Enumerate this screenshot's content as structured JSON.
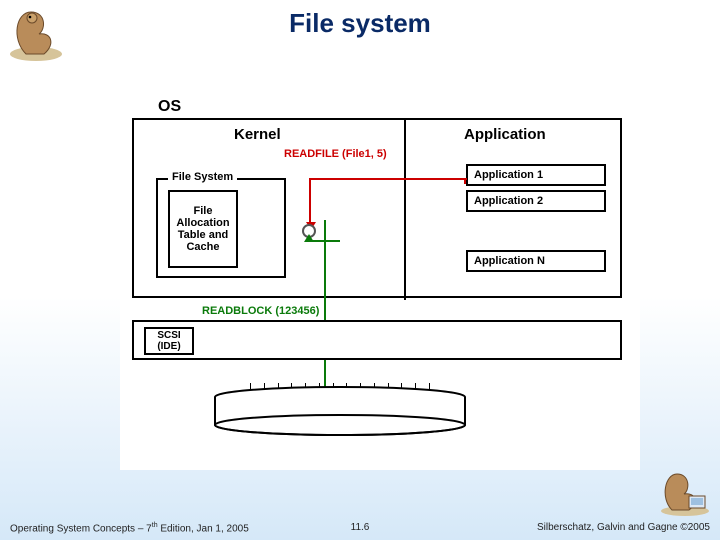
{
  "title": "File system",
  "diagram": {
    "os_label": "OS",
    "kernel_label": "Kernel",
    "application_label": "Application",
    "readfile_label": "READFILE (File1, 5)",
    "apps": [
      "Application 1",
      "Application 2",
      "Application N"
    ],
    "file_system": {
      "box_title": "File System",
      "inner": "File Allocation Table and Cache"
    },
    "readblock_label": "READBLOCK (123456)",
    "scsi_label": "SCSI (IDE)",
    "colors": {
      "readfile": "#cc0000",
      "readblock": "#0a7a0a",
      "border": "#000000"
    }
  },
  "footer": {
    "left_prefix": "Operating System Concepts – 7",
    "left_suffix": " Edition, Jan 1, 2005",
    "th": "th",
    "center": "11.6",
    "right": "Silberschatz, Galvin and Gagne ©2005"
  }
}
